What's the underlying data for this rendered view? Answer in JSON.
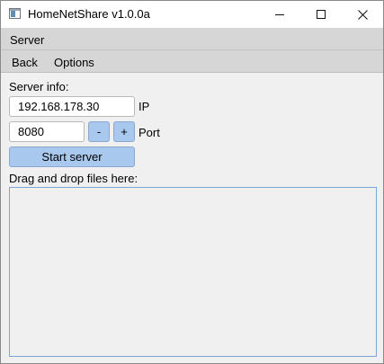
{
  "window": {
    "title": "HomeNetShare v1.0.0a",
    "icon": "app-window-icon"
  },
  "menubar": {
    "items": [
      {
        "label": "Server"
      }
    ]
  },
  "toolbar": {
    "back_label": "Back",
    "options_label": "Options"
  },
  "server": {
    "info_label": "Server info:",
    "ip_value": "192.168.178.30",
    "ip_label": "IP",
    "port_value": "8080",
    "port_label": "Port",
    "decrement_label": "-",
    "increment_label": "+",
    "start_label": "Start server"
  },
  "dropzone": {
    "label": "Drag and drop files here:"
  },
  "colors": {
    "accent_button": "#a9c8ee",
    "dropzone_border": "#7aa6d6",
    "bar_background": "#d6d6d6",
    "window_background": "#f0f0f0"
  }
}
